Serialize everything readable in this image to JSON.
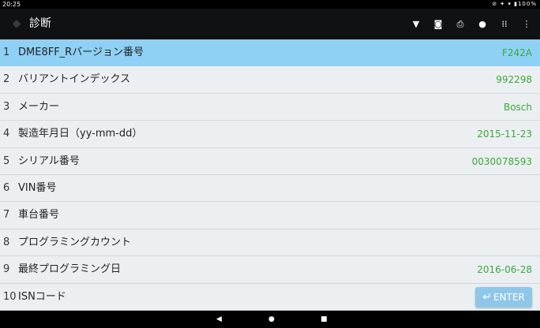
{
  "status_bar": {
    "time": "20:25",
    "indicators": "⊘ ✦ ▾ ▮100%"
  },
  "title_bar": {
    "title": "診断",
    "tools": [
      "wifi-icon",
      "camera-icon",
      "print-icon",
      "info-icon",
      "grid-icon",
      "more-icon"
    ]
  },
  "rows": [
    {
      "index": "1",
      "label": "DME8FF_Rバージョン番号",
      "value": "F242A"
    },
    {
      "index": "2",
      "label": "バリアントインデックス",
      "value": "992298"
    },
    {
      "index": "3",
      "label": "メーカー",
      "value": "Bosch"
    },
    {
      "index": "4",
      "label": "製造年月日（yy-mm-dd）",
      "value": "2015-11-23"
    },
    {
      "index": "5",
      "label": "シリアル番号",
      "value": "0030078593"
    },
    {
      "index": "6",
      "label": "VIN番号",
      "value": ""
    },
    {
      "index": "7",
      "label": "車台番号",
      "value": ""
    },
    {
      "index": "8",
      "label": "プログラミングカウント",
      "value": ""
    },
    {
      "index": "9",
      "label": "最終プログラミング日",
      "value": "2016-06-28"
    },
    {
      "index": "10",
      "label": "ISNコード",
      "value": ""
    }
  ],
  "enter_button": {
    "label": "ENTER"
  },
  "colors": {
    "selected_row": "#8fd0f5",
    "value_text": "#39a83a",
    "title_bar": "#101113"
  }
}
